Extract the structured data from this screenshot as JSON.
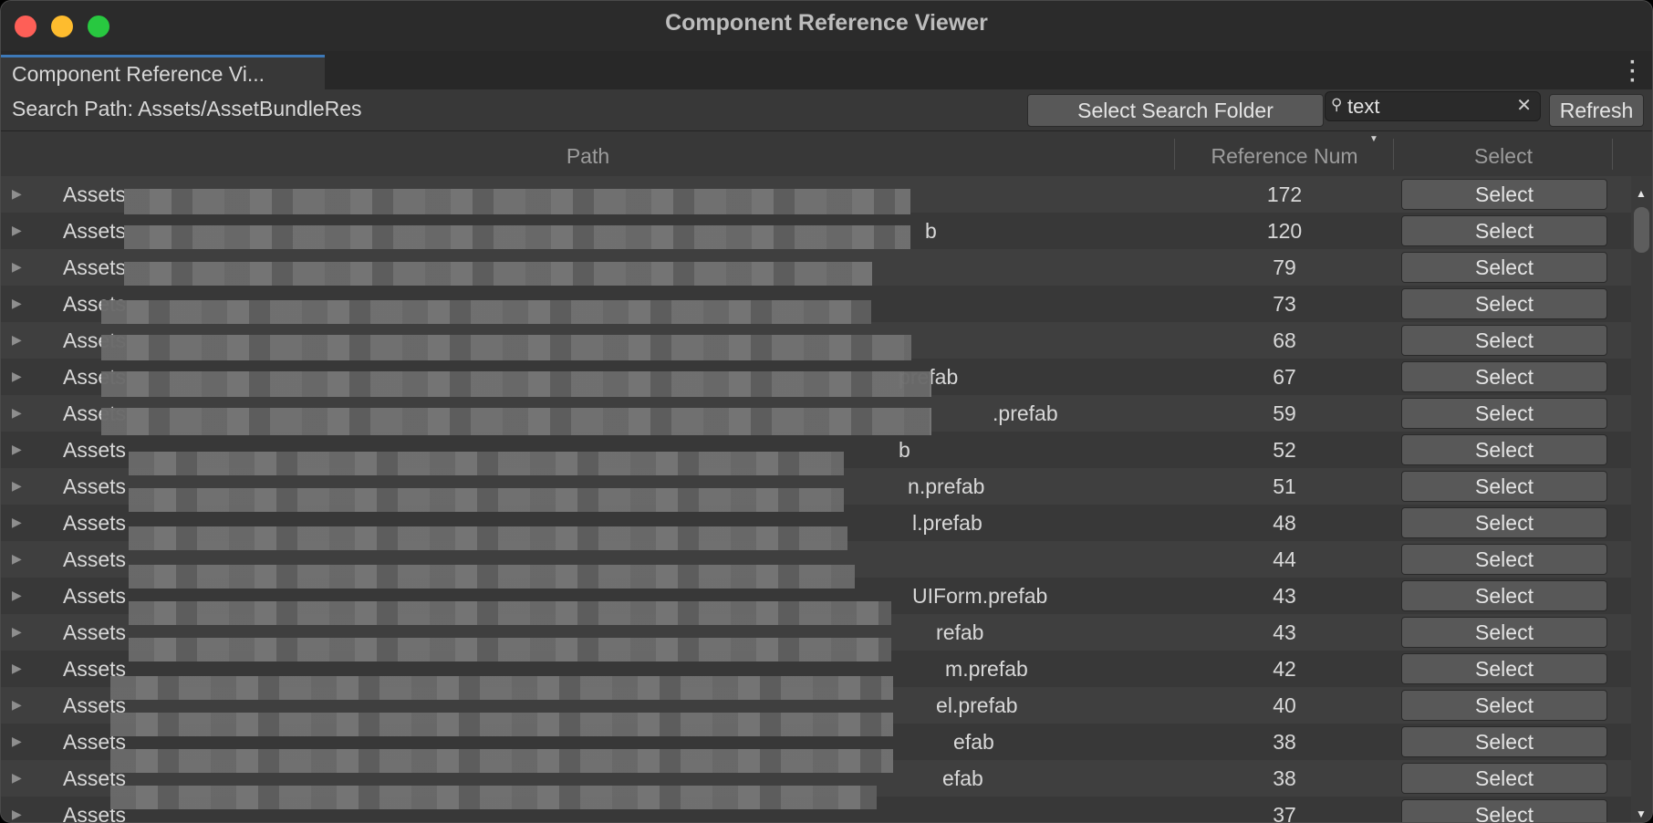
{
  "window": {
    "title": "Component Reference Viewer",
    "tab_label": "Component Reference Vi..."
  },
  "toolbar": {
    "search_path": "Search Path: Assets/AssetBundleRes",
    "select_folder_label": "Select Search Folder",
    "search_value": "text",
    "refresh_label": "Refresh"
  },
  "columns": {
    "path": "Path",
    "reference_num": "Reference Num",
    "select": "Select"
  },
  "rows": [
    {
      "path_prefix": "Assets",
      "path_suffix": "",
      "ref": "172",
      "button": "Select"
    },
    {
      "path_prefix": "Assets",
      "path_suffix": "b",
      "ref": "120",
      "button": "Select"
    },
    {
      "path_prefix": "Assets",
      "path_suffix": "",
      "ref": "79",
      "button": "Select"
    },
    {
      "path_prefix": "Assets",
      "path_suffix": "",
      "ref": "73",
      "button": "Select"
    },
    {
      "path_prefix": "Assets",
      "path_suffix": "",
      "ref": "68",
      "button": "Select"
    },
    {
      "path_prefix": "Assets",
      "path_suffix": "prefab",
      "ref": "67",
      "button": "Select"
    },
    {
      "path_prefix": "Assets",
      "path_suffix": ".prefab",
      "ref": "59",
      "button": "Select"
    },
    {
      "path_prefix": "Assets",
      "path_suffix": "b",
      "ref": "52",
      "button": "Select"
    },
    {
      "path_prefix": "Assets",
      "path_suffix": "n.prefab",
      "ref": "51",
      "button": "Select"
    },
    {
      "path_prefix": "Assets",
      "path_suffix": "l.prefab",
      "ref": "48",
      "button": "Select"
    },
    {
      "path_prefix": "Assets",
      "path_suffix": "",
      "ref": "44",
      "button": "Select"
    },
    {
      "path_prefix": "Assets",
      "path_suffix": "UIForm.prefab",
      "ref": "43",
      "button": "Select"
    },
    {
      "path_prefix": "Assets",
      "path_suffix": "refab",
      "ref": "43",
      "button": "Select"
    },
    {
      "path_prefix": "Assets",
      "path_suffix": "m.prefab",
      "ref": "42",
      "button": "Select"
    },
    {
      "path_prefix": "Assets",
      "path_suffix": "el.prefab",
      "ref": "40",
      "button": "Select"
    },
    {
      "path_prefix": "Assets",
      "path_suffix": "efab",
      "ref": "38",
      "button": "Select"
    },
    {
      "path_prefix": "Assets",
      "path_suffix": "efab",
      "ref": "38",
      "button": "Select"
    },
    {
      "path_prefix": "Assets",
      "path_suffix": "",
      "ref": "37",
      "button": "Select"
    }
  ]
}
